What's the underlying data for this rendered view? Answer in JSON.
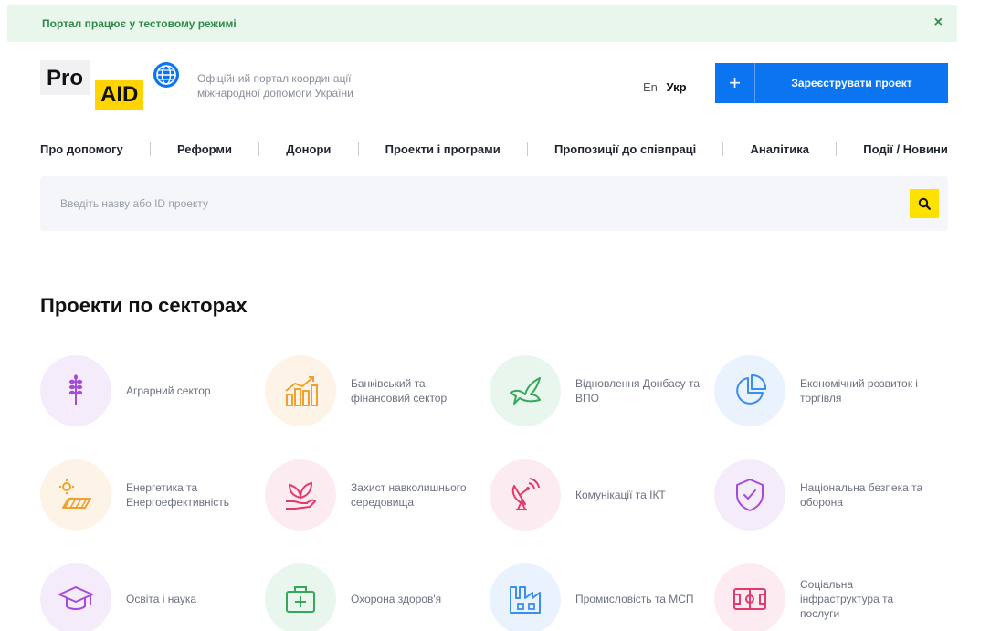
{
  "banner": {
    "text": "Портал працює у тестовому режимі",
    "close": "×"
  },
  "logo": {
    "pro": "Pro",
    "aid": "AID"
  },
  "tagline": {
    "line1": "Офіційний портал координації",
    "line2": "міжнародної допомоги України"
  },
  "lang": {
    "en": "En",
    "uk": "Укр"
  },
  "register": {
    "plus": "+",
    "label": "Зареєструвати проект"
  },
  "nav": [
    "Про допомогу",
    "Реформи",
    "Донори",
    "Проекти і програми",
    "Пропозиції до співпраці",
    "Аналітика",
    "Події / Новини"
  ],
  "search": {
    "placeholder": "Введіть назву або ID проекту"
  },
  "sectors_title": "Проекти по секторах",
  "sectors": [
    {
      "label": "Аграрний сектор",
      "icon": "wheat-icon",
      "color": "#a64ad9",
      "bg": "#f5ecfb"
    },
    {
      "label": "Банківський та фінансовий сектор",
      "icon": "finance-chart-icon",
      "color": "#f0a030",
      "bg": "#fdf3e6"
    },
    {
      "label": "Відновлення Донбасу та ВПО",
      "icon": "dove-icon",
      "color": "#36a85a",
      "bg": "#e9f6ed"
    },
    {
      "label": "Економічний розвиток і торгівля",
      "icon": "pie-chart-icon",
      "color": "#3a8ef0",
      "bg": "#eaf3fd"
    },
    {
      "label": "Енергетика та Енергоефективність",
      "icon": "energy-icon",
      "color": "#f0a030",
      "bg": "#fdf3e6"
    },
    {
      "label": "Захист навколишнього середовища",
      "icon": "plant-hand-icon",
      "color": "#e23a6a",
      "bg": "#fcebf0"
    },
    {
      "label": "Комунікації та ІКТ",
      "icon": "satellite-dish-icon",
      "color": "#e23a6a",
      "bg": "#fcebf0"
    },
    {
      "label": "Національна безпека та оборона",
      "icon": "shield-check-icon",
      "color": "#a64ad9",
      "bg": "#f5ecfb"
    },
    {
      "label": "Освіта і наука",
      "icon": "graduation-cap-icon",
      "color": "#a64ad9",
      "bg": "#f5ecfb"
    },
    {
      "label": "Охорона здоров'я",
      "icon": "medical-kit-icon",
      "color": "#36a85a",
      "bg": "#e9f6ed"
    },
    {
      "label": "Промисловість та МСП",
      "icon": "factory-icon",
      "color": "#3a8ef0",
      "bg": "#eaf3fd"
    },
    {
      "label": "Соціальна інфраструктура та послуги",
      "icon": "stadium-icon",
      "color": "#e23a6a",
      "bg": "#fcebf0"
    }
  ]
}
